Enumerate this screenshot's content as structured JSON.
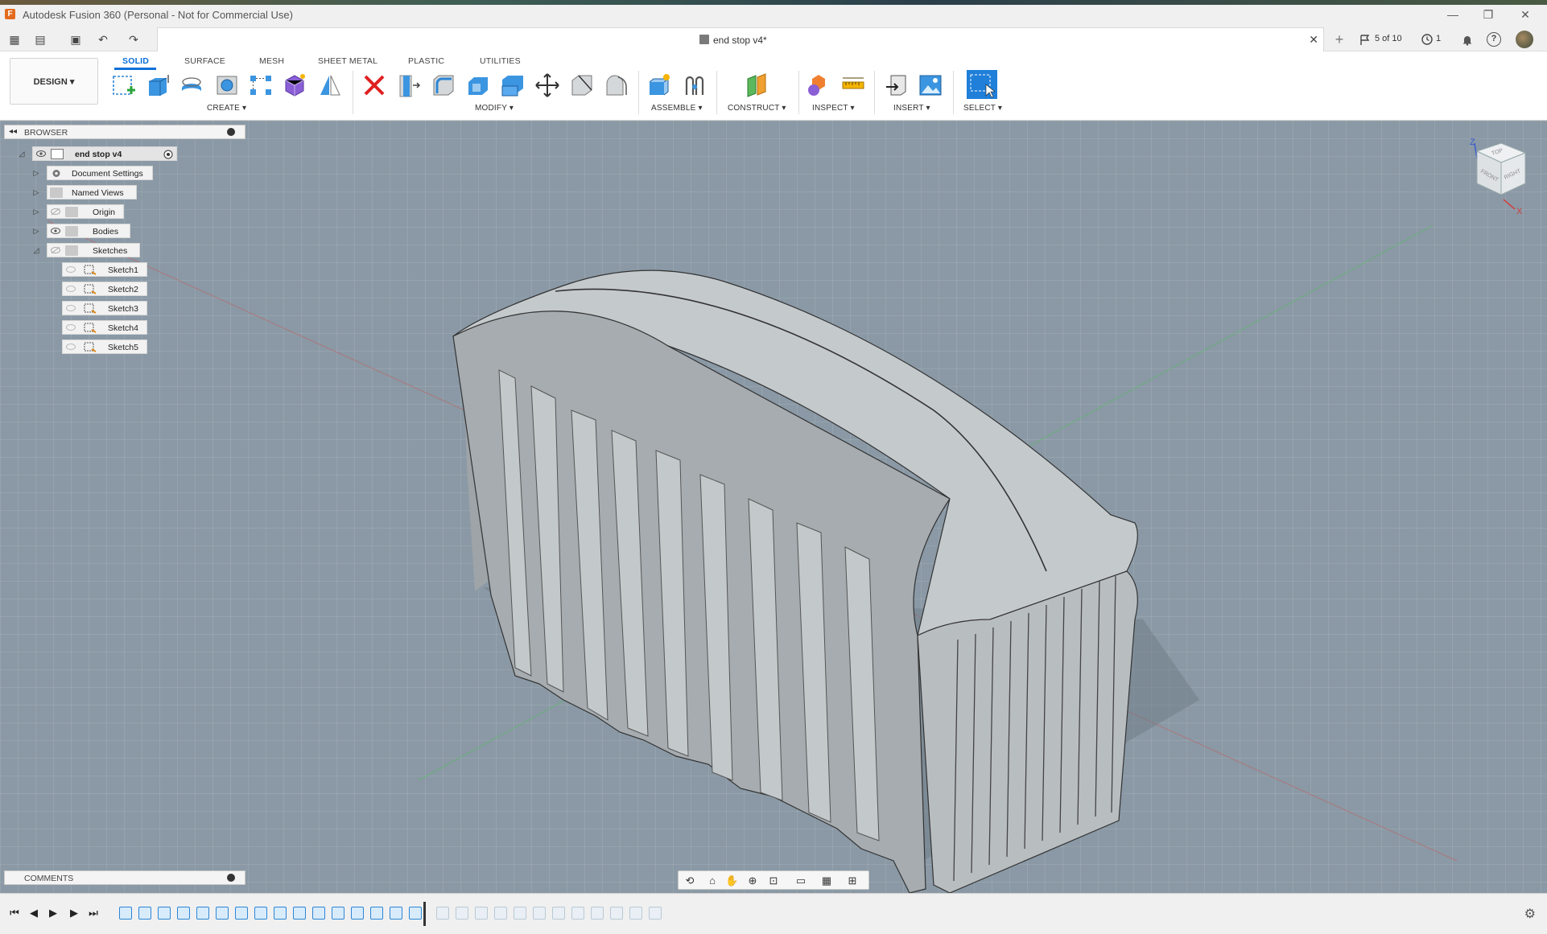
{
  "window": {
    "title": "Autodesk Fusion 360 (Personal - Not for Commercial Use)",
    "app_icon_letter": "F",
    "controls": {
      "minimize": "—",
      "restore": "❐",
      "close": "✕"
    }
  },
  "appbar": {
    "document_tab": "end stop v4*",
    "tab_close": "✕",
    "new_tab": "+",
    "job_status": "5 of 10",
    "clock_count": "1",
    "icons": {
      "grid": "▦",
      "file": "▤",
      "save": "▣",
      "undo": "↶",
      "redo": "↷",
      "bell": "🔔",
      "help": "?"
    }
  },
  "toolbar": {
    "workspace_button": "DESIGN ▾",
    "tabs": [
      "SOLID",
      "SURFACE",
      "MESH",
      "SHEET METAL",
      "PLASTIC",
      "UTILITIES"
    ],
    "active_tab": "SOLID",
    "groups": {
      "create": "CREATE ▾",
      "modify": "MODIFY ▾",
      "assemble": "ASSEMBLE ▾",
      "construct": "CONSTRUCT ▾",
      "inspect": "INSPECT ▾",
      "insert": "INSERT ▾",
      "select": "SELECT ▾"
    }
  },
  "browser": {
    "header": "BROWSER",
    "collapse_icon": "◂◂",
    "root": "end stop v4",
    "items": [
      {
        "label": "Document Settings",
        "icon": "gear-icon"
      },
      {
        "label": "Named Views",
        "icon": "folder-icon"
      },
      {
        "label": "Origin",
        "icon": "folder-icon"
      },
      {
        "label": "Bodies",
        "icon": "folder-icon"
      },
      {
        "label": "Sketches",
        "icon": "folder-icon"
      }
    ],
    "sketches": [
      "Sketch1",
      "Sketch2",
      "Sketch3",
      "Sketch4",
      "Sketch5"
    ]
  },
  "viewcube": {
    "top": "TOP",
    "front": "FRONT",
    "right": "RIGHT",
    "axis_z": "Z",
    "axis_x": "X"
  },
  "comments": {
    "header": "COMMENTS"
  },
  "navbar": {
    "icons": [
      "orbit-icon",
      "look-at-icon",
      "pan-icon",
      "zoom-icon",
      "fit-icon",
      "display-settings-icon",
      "grid-icon",
      "viewports-icon"
    ]
  },
  "timeline": {
    "controls": {
      "first": "⏮",
      "prev": "◀",
      "play": "▶",
      "next": "▶",
      "last": "⏭"
    },
    "active_features": 16,
    "suppressed_features": 12,
    "settings_icon": "⚙"
  },
  "colors": {
    "accent": "#0a6fd8",
    "viewport_bg": "#8a99a5",
    "model_fill": "#bfc4c6"
  }
}
